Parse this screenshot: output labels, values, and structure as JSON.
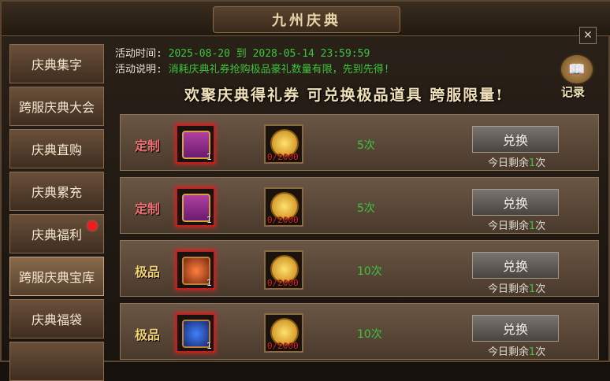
{
  "window": {
    "title": "九州庆典",
    "close_icon": "close-icon"
  },
  "sidebar": {
    "items": [
      {
        "label": "庆典集字",
        "active": false,
        "dot": false
      },
      {
        "label": "跨服庆典大会",
        "active": false,
        "dot": false
      },
      {
        "label": "庆典直购",
        "active": false,
        "dot": false
      },
      {
        "label": "庆典累充",
        "active": false,
        "dot": false
      },
      {
        "label": "庆典福利",
        "active": false,
        "dot": true
      },
      {
        "label": "跨服庆典宝库",
        "active": true,
        "dot": false
      },
      {
        "label": "庆典福袋",
        "active": false,
        "dot": false
      }
    ]
  },
  "info": {
    "time_label": "活动时间:",
    "time_value": "2025-08-20 到 2028-05-14 23:59:59",
    "desc_label": "活动说明:",
    "desc_value": "消耗庆典礼券抢购极品豪礼数量有限，先到先得!"
  },
  "slogan": "欢聚庆典得礼券 可兑换极品道具 跨服限量!",
  "record": {
    "label": "记录",
    "icon": "book-icon"
  },
  "rows": [
    {
      "category": "定制",
      "prize_qty": "1",
      "cost": "0/2000",
      "times": "5次",
      "button": "兑换",
      "remain_prefix": "今日剩余",
      "remain_num": "1",
      "remain_suffix": "次"
    },
    {
      "category": "定制",
      "prize_qty": "1",
      "cost": "0/2000",
      "times": "5次",
      "button": "兑换",
      "remain_prefix": "今日剩余",
      "remain_num": "1",
      "remain_suffix": "次"
    },
    {
      "category": "极品",
      "prize_qty": "1",
      "cost": "0/2000",
      "times": "10次",
      "button": "兑换",
      "remain_prefix": "今日剩余",
      "remain_num": "1",
      "remain_suffix": "次"
    },
    {
      "category": "极品",
      "prize_qty": "1",
      "cost": "0/2000",
      "times": "10次",
      "button": "兑换",
      "remain_prefix": "今日剩余",
      "remain_num": "1",
      "remain_suffix": "次"
    }
  ]
}
